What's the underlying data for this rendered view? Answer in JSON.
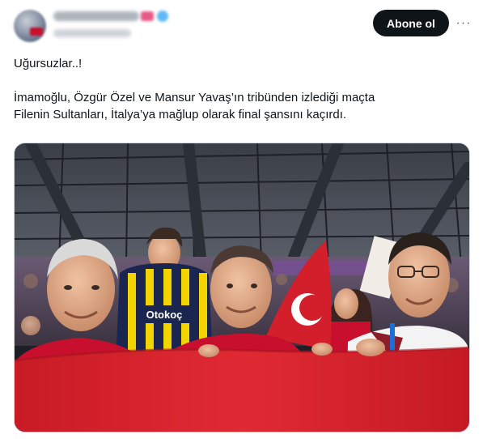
{
  "author": {
    "name": "",
    "handle": "",
    "avatar_icon": "avatar-blurred",
    "badges": [
      "red-badge-icon",
      "verified-badge-icon"
    ]
  },
  "header": {
    "follow_label": "Abone ol",
    "more_icon": "more-horizontal-icon",
    "more_glyph": "···"
  },
  "tweet": {
    "lines": [
      "Uğursuzlar..!",
      "",
      "İmamoğlu, Özgür Özel ve Mansur Yavaş’ın tribünden izlediği maçta",
      "Filenin Sultanları, İtalya’ya mağlup olarak final şansını kaçırdı."
    ]
  },
  "media": {
    "type": "photo",
    "jersey_text": "Otokoç",
    "colors": {
      "flag_red": "#d21f2b",
      "shirt_red": "#c8102e",
      "fb_navy": "#1b2650",
      "fb_yellow": "#f2d500",
      "roof": "#2a2d33"
    }
  },
  "colors": {
    "text": "#0f1419",
    "muted": "#536471",
    "button_bg": "#0f1419",
    "button_text": "#ffffff",
    "border": "#cfd9de"
  }
}
